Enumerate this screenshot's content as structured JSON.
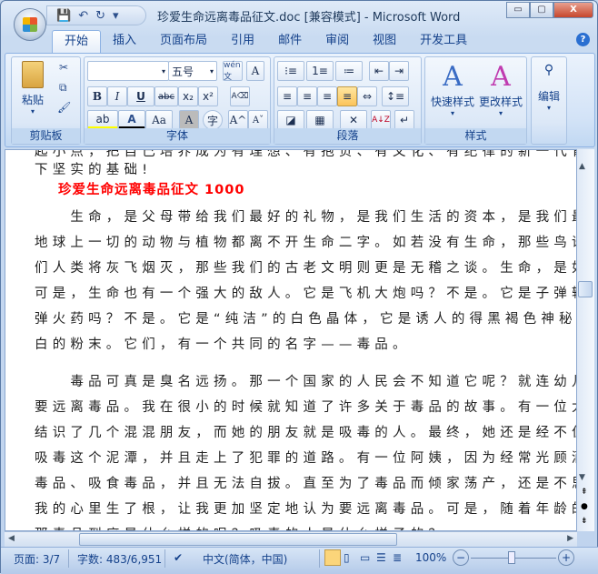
{
  "window": {
    "title": "珍爱生命远离毒品征文.doc [兼容模式] - Microsoft Word",
    "minimize": "▭",
    "restore": "▢",
    "close": "X"
  },
  "qat": {
    "save": "💾",
    "undo": "↶",
    "redo": "↻",
    "more": "▾"
  },
  "tabs": [
    "开始",
    "插入",
    "页面布局",
    "引用",
    "邮件",
    "审阅",
    "视图",
    "开发工具"
  ],
  "help": "?",
  "ribbon": {
    "clipboard": {
      "label": "剪贴板",
      "paste": "粘贴",
      "cut": "✂",
      "copy": "⧉",
      "format_painter": "🖌"
    },
    "font": {
      "label": "字体",
      "font_name": "",
      "font_size": "五号",
      "phonetic": "wén文",
      "char_border": "A",
      "bold": "B",
      "italic": "I",
      "underline": "U",
      "strike": "abc",
      "subscript": "x₂",
      "superscript": "x²",
      "clear": "A⌫",
      "highlight": "ab",
      "font_color": "A",
      "change_case": "Aa",
      "char_shading": "A",
      "enclose": "字",
      "grow": "A^",
      "shrink": "Aˇ"
    },
    "paragraph": {
      "label": "段落",
      "bullets": "⁝≡",
      "numbering": "1≡",
      "multilevel": "≔",
      "dec_indent": "⇤",
      "inc_indent": "⇥",
      "align_left": "≡",
      "center": "≡",
      "align_right": "≡",
      "justify": "≡",
      "distributed": "⇔",
      "line_spacing": "↕≡",
      "shading": "◪",
      "borders": "▦",
      "chinese_layout": "✕",
      "sort": "A↓Z",
      "show_marks": "↵"
    },
    "styles": {
      "label": "样式",
      "quick": "快速样式",
      "change": "更改样式"
    },
    "editing": {
      "label": "编辑"
    }
  },
  "document": {
    "lines": [
      "起小点，把自己培养成为有理想、有抱负、有文化、有纪律的新一代青年，为美好的明天打",
      "下坚实的基础!",
      "珍爱生命远离毒品征文 1000",
      "　　生命，是父母带给我们最好的礼物，是我们生活的资本，是我们最应该珍惜的东西。",
      "地球上一切的动物与植物都离不开生命二字。如若没有生命，那些鸟语花香将不复存在，我",
      "们人类将灰飞烟灭，那些我们的古老文明则更是无稽之谈。生命，是如此美丽，如此可爱。",
      "可是，生命也有一个强大的敌人。它是飞机大炮吗？不是。它是子弹轮船吗？不是。它是炸",
      "弹火药吗？不是。它是“纯洁”的白色晶体，它是诱人的得黑褐色神秘药丸，它是细腻而又雪",
      "白的粉末。它们，有一个共同的名字——毒品。",
      "　　毒品可真是臭名远扬。那一个国家的人民会不知道它呢？就连幼儿园的小宝贝都明白",
      "要远离毒品。我在很小的时候就知道了许多关于毒品的故事。有一位大姐姐，因为父母离婚",
      "结识了几个混混朋友，而她的朋友就是吸毒的人。最终，她还是经不住朋友的诱惑，进入了",
      "吸毒这个泥潭，并且走上了犯罪的道路。有一位阿姨，因为经常光顾酒吧和迪厅而开始接触",
      "毒品、吸食毒品，并且无法自拔。直至为了毒品而倾家荡产，还是不思悔改……这些故事在",
      "我的心里生了根，让我更加坚定地认为要远离毒品。可是，随着年龄的增长，我却怀疑了。",
      "那毒品到底是什么样的呢？吸毒的人是什么样子的？"
    ]
  },
  "status": {
    "page": "页面: 3/7",
    "words": "字数: 483/6,951",
    "language": "中文(简体，中国)",
    "zoom": "100%",
    "zoom_out": "−",
    "zoom_in": "+"
  }
}
